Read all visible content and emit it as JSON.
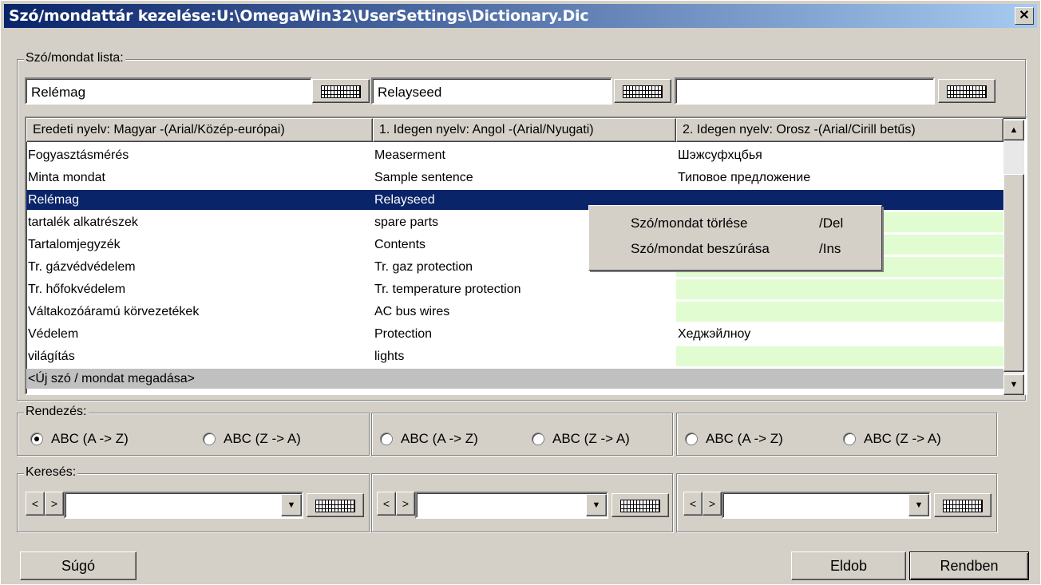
{
  "window": {
    "title": "Szó/mondattár kezelése:U:\\OmegaWin32\\UserSettings\\Dictionary.Dic",
    "close": "✕"
  },
  "list_group": {
    "legend": "Szó/mondat lista:",
    "inputs": [
      "Relémag",
      "Relayseed",
      ""
    ],
    "headers": [
      "Eredeti nyelv: Magyar -(Arial/Közép-európai)",
      "1. Idegen nyelv: Angol -(Arial/Nyugati)",
      "2. Idegen nyelv: Orosz -(Arial/Cirill betűs)"
    ],
    "rows": [
      {
        "c0": "Fogyasztásmérés",
        "c1": "Measerment",
        "c2": "Шэжсуфхцбья",
        "green": false
      },
      {
        "c0": "Minta mondat",
        "c1": "Sample sentence",
        "c2": "Типовое предложение",
        "green": false
      },
      {
        "c0": "Relémag",
        "c1": "Relayseed",
        "c2": "",
        "green": false
      },
      {
        "c0": "tartalék alkatrészek",
        "c1": "spare parts",
        "c2": "",
        "green": true
      },
      {
        "c0": "Tartalomjegyzék",
        "c1": "Contents",
        "c2": "",
        "green": true
      },
      {
        "c0": "Tr. gázvédvédelem",
        "c1": "Tr. gaz protection",
        "c2": "",
        "green": true
      },
      {
        "c0": "Tr. hőfokvédelem",
        "c1": "Tr. temperature protection",
        "c2": "",
        "green": true
      },
      {
        "c0": "Váltakozóáramú körvezetékek",
        "c1": "AC bus wires",
        "c2": "",
        "green": true
      },
      {
        "c0": "Védelem",
        "c1": "Protection",
        "c2": "Хеджэйлноу",
        "green": false
      },
      {
        "c0": "világítás",
        "c1": "lights",
        "c2": "",
        "green": true
      }
    ],
    "selected_row": 2,
    "new_row": "<Új szó / mondat  megadása>"
  },
  "context_menu": {
    "items": [
      {
        "label": "Szó/mondat törlése",
        "shortcut": "/Del"
      },
      {
        "label": "Szó/mondat beszúrása",
        "shortcut": "/Ins"
      }
    ]
  },
  "sort": {
    "legend": "Rendezés:",
    "asc": "ABC (A -> Z)",
    "desc": "ABC (Z -> A)"
  },
  "search": {
    "legend": "Keresés:",
    "prev": "<",
    "next": ">"
  },
  "buttons": {
    "help": "Súgó",
    "cancel": "Eldob",
    "ok": "Rendben"
  }
}
